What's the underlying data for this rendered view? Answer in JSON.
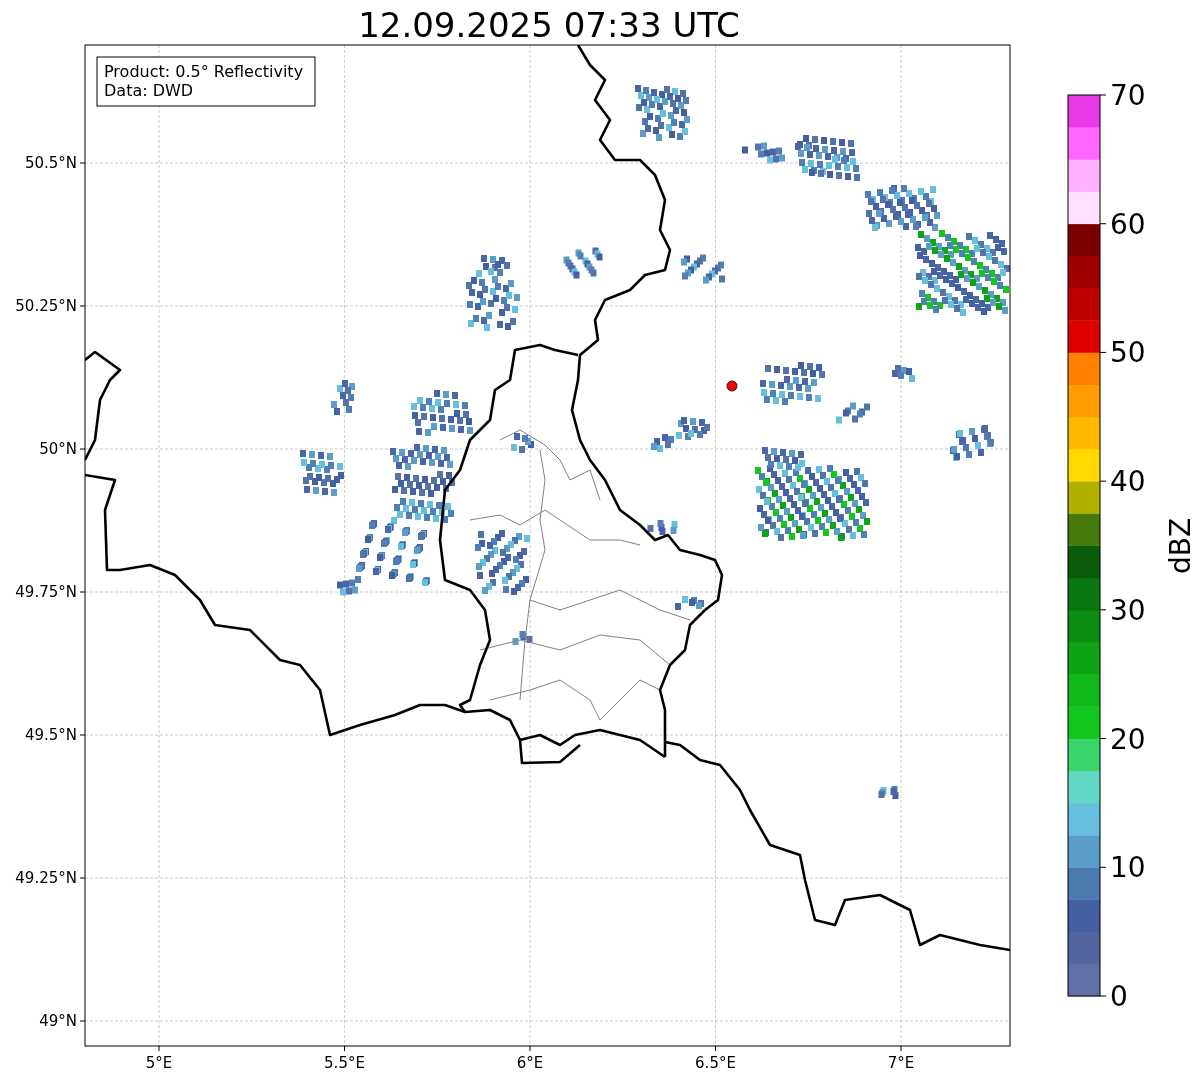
{
  "title": "12.09.2025 07:33 UTC",
  "legend": [
    "Product: 0.5° Reflectivity",
    "Data: DWD"
  ],
  "map": {
    "xticks": [
      "5°E",
      "5.5°E",
      "6°E",
      "6.5°E",
      "7°E"
    ],
    "yticks": [
      "50.5°N",
      "50.25°N",
      "50°N",
      "49.75°N",
      "49.5°N",
      "49.25°N",
      "49°N"
    ]
  },
  "colorbar": {
    "label": "dBZ",
    "ticks": [
      "70",
      "60",
      "50",
      "40",
      "30",
      "20",
      "10",
      "0"
    ],
    "segments": [
      {
        "color": "#6370a6"
      },
      {
        "color": "#5466a0"
      },
      {
        "color": "#4560a2"
      },
      {
        "color": "#4a7ab0"
      },
      {
        "color": "#5a9ec8"
      },
      {
        "color": "#66bfdc"
      },
      {
        "color": "#60d8c4"
      },
      {
        "color": "#3cd46c"
      },
      {
        "color": "#12c81c"
      },
      {
        "color": "#10b81a"
      },
      {
        "color": "#0ea416"
      },
      {
        "color": "#0c8e12"
      },
      {
        "color": "#0a7610"
      },
      {
        "color": "#085c0c"
      },
      {
        "color": "#467a0c"
      },
      {
        "color": "#b0b000"
      },
      {
        "color": "#ffd800"
      },
      {
        "color": "#ffb800"
      },
      {
        "color": "#ff9c00"
      },
      {
        "color": "#ff7f00"
      },
      {
        "color": "#e00000"
      },
      {
        "color": "#c00000"
      },
      {
        "color": "#a00000"
      },
      {
        "color": "#7a0000"
      },
      {
        "color": "#ffe0ff"
      },
      {
        "color": "#ffb0ff"
      },
      {
        "color": "#ff66ff"
      },
      {
        "color": "#e838e8"
      }
    ]
  }
}
